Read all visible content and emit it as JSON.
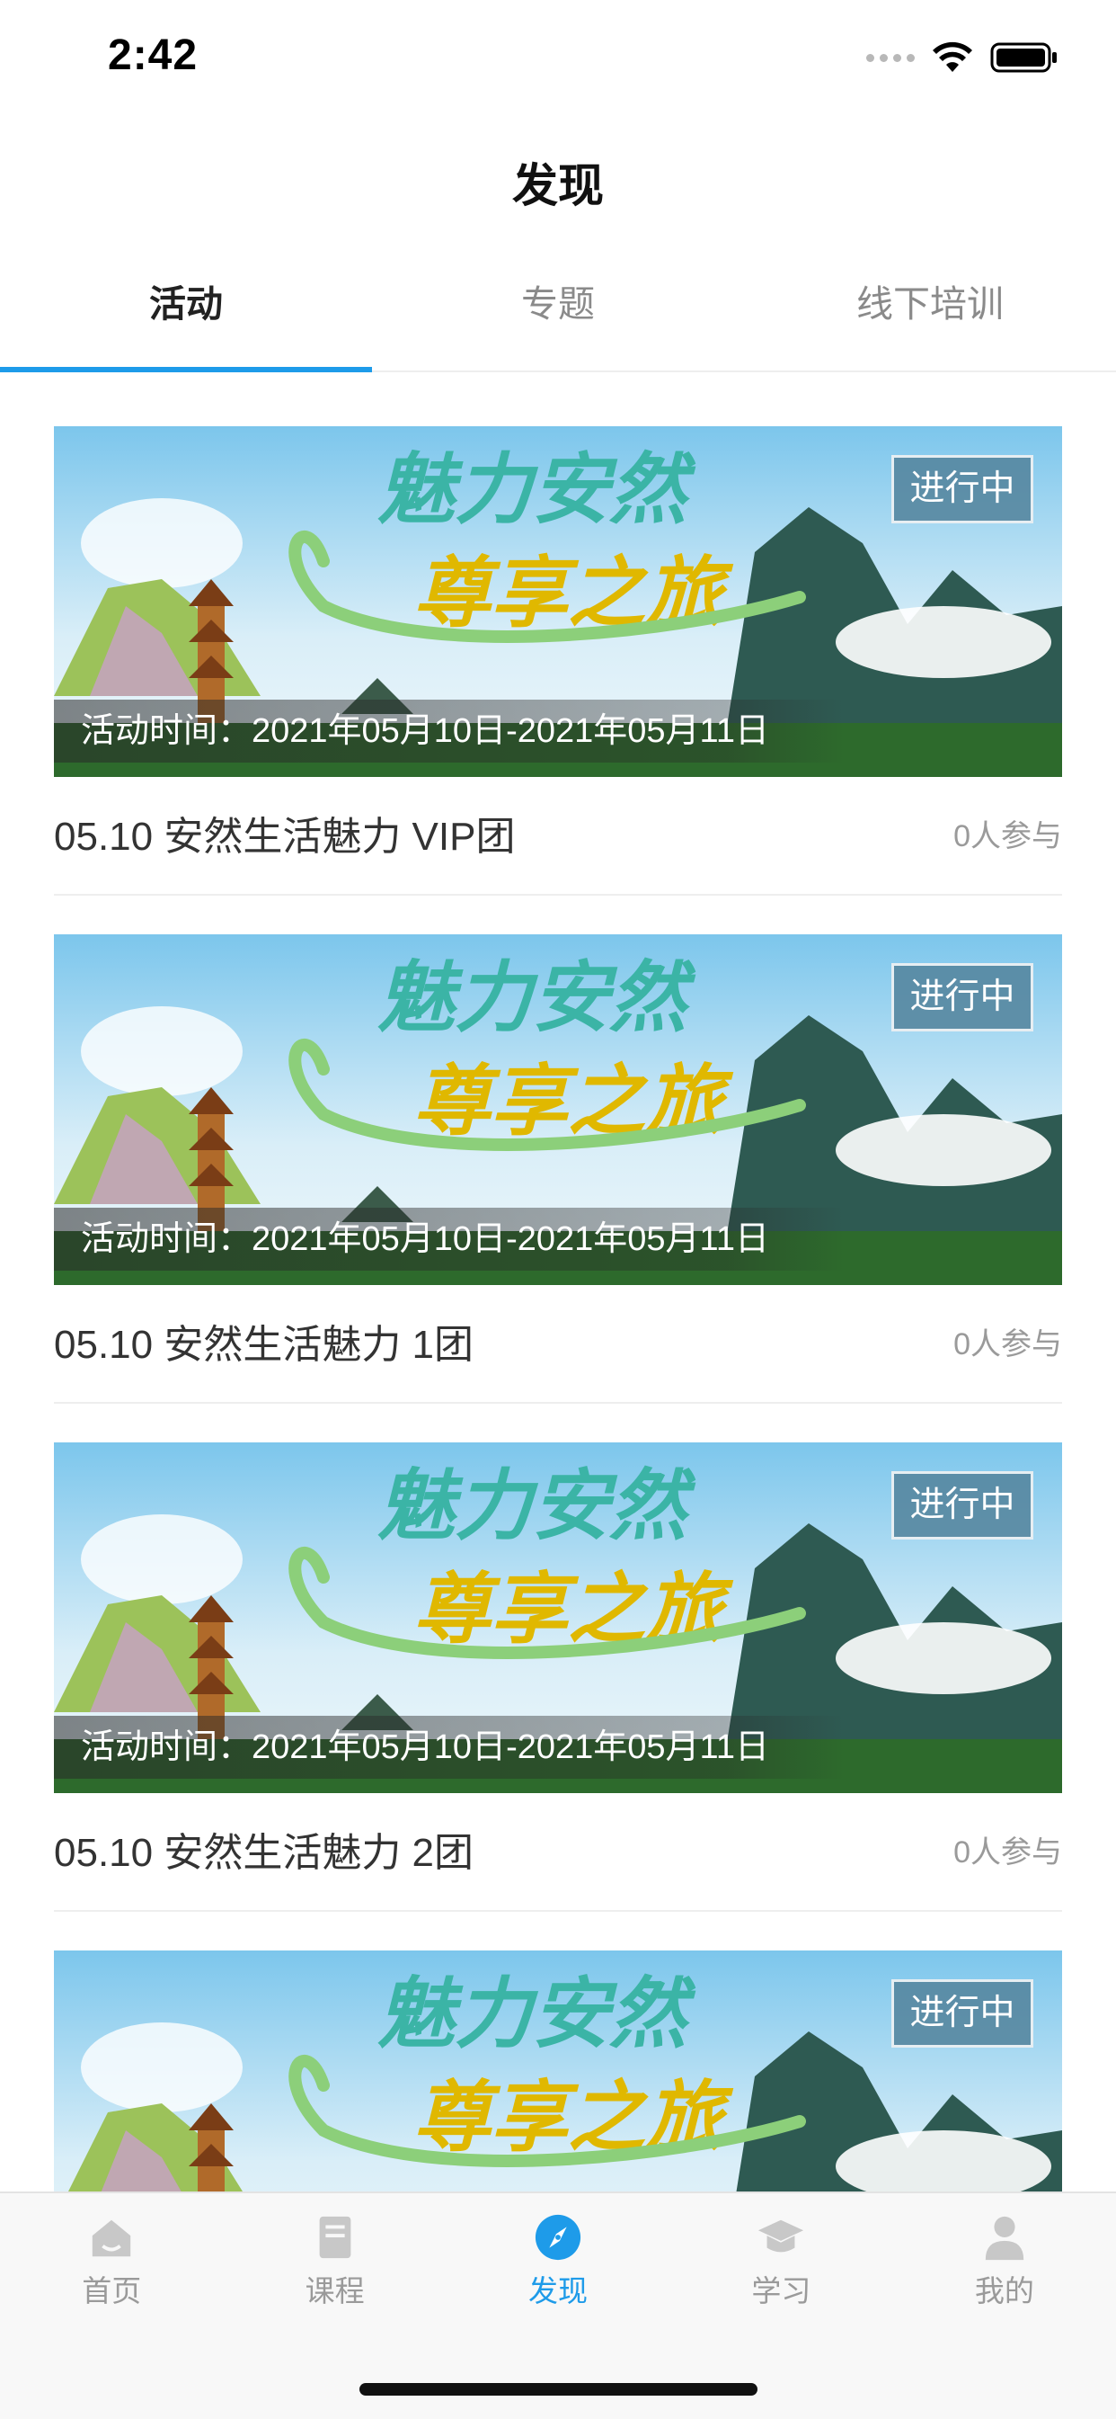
{
  "status_bar": {
    "time": "2:42"
  },
  "page_title": "发现",
  "tabs": [
    {
      "label": "活动",
      "active": true
    },
    {
      "label": "专题",
      "active": false
    },
    {
      "label": "线下培训",
      "active": false
    }
  ],
  "activities": [
    {
      "banner_text_top": "魅力安然",
      "banner_text_bottom": "尊享之旅",
      "status": "进行中",
      "time": "活动时间：2021年05月10日-2021年05月11日",
      "title": "05.10 安然生活魅力 VIP团",
      "participants": "0人参与"
    },
    {
      "banner_text_top": "魅力安然",
      "banner_text_bottom": "尊享之旅",
      "status": "进行中",
      "time": "活动时间：2021年05月10日-2021年05月11日",
      "title": "05.10 安然生活魅力 1团",
      "participants": "0人参与"
    },
    {
      "banner_text_top": "魅力安然",
      "banner_text_bottom": "尊享之旅",
      "status": "进行中",
      "time": "活动时间：2021年05月10日-2021年05月11日",
      "title": "05.10 安然生活魅力 2团",
      "participants": "0人参与"
    },
    {
      "banner_text_top": "魅力安然",
      "banner_text_bottom": "尊享之旅",
      "status": "进行中"
    }
  ],
  "bottom_tabs": [
    {
      "label": "首页",
      "icon": "home-icon",
      "active": false
    },
    {
      "label": "课程",
      "icon": "book-icon",
      "active": false
    },
    {
      "label": "发现",
      "icon": "compass-icon",
      "active": true
    },
    {
      "label": "学习",
      "icon": "graduation-cap-icon",
      "active": false
    },
    {
      "label": "我的",
      "icon": "person-icon",
      "active": false
    }
  ],
  "colors": {
    "accent": "#1e9be9",
    "inactive": "#9a9a9a",
    "badge_bg": "#52829b"
  }
}
